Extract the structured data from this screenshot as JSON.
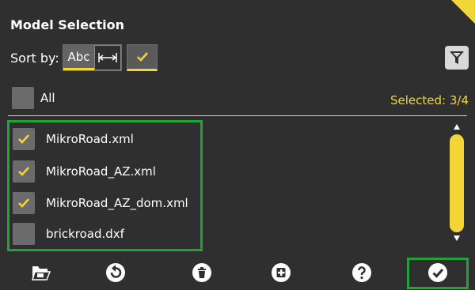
{
  "header": {
    "title": "Model Selection"
  },
  "sort": {
    "label": "Sort by:",
    "abc_label": "Abc"
  },
  "select_all": {
    "label": "All",
    "checked": false
  },
  "selected_count": "Selected: 3/4",
  "files": [
    {
      "name": "MikroRoad.xml",
      "checked": true
    },
    {
      "name": "MikroRoad_AZ.xml",
      "checked": true
    },
    {
      "name": "MikroRoad_AZ_dom.xml",
      "checked": true
    },
    {
      "name": "brickroad.dxf",
      "checked": false
    }
  ],
  "toolbar": {
    "icons": [
      "open-folder-icon",
      "undo-icon",
      "trash-icon",
      "add-icon",
      "help-icon",
      "confirm-icon"
    ]
  },
  "colors": {
    "accent": "#f2d637",
    "background": "#2f2f2f",
    "highlight_frame": "#1fa33a"
  }
}
